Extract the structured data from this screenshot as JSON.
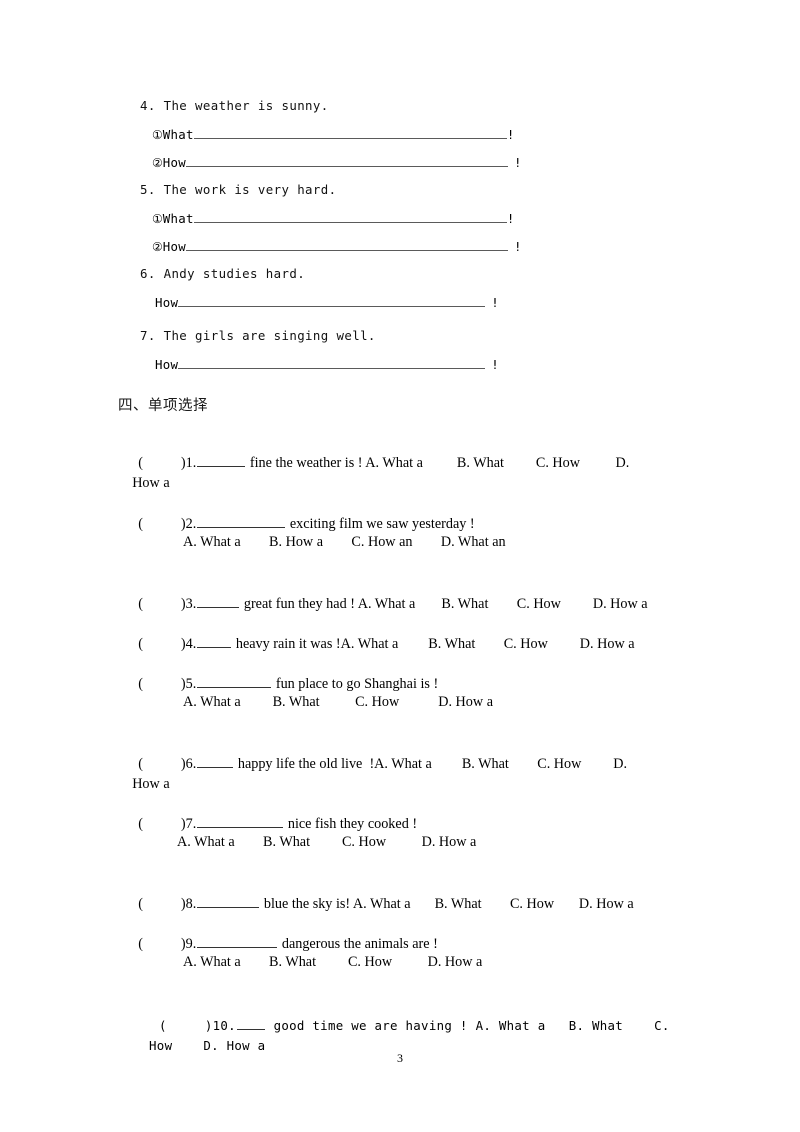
{
  "document": {
    "page_number": "3",
    "section_heading": "四、单项选择"
  },
  "fill_in_exercises": [
    {
      "number": "4.",
      "stem": "4. The weather is sunny.",
      "answers": [
        {
          "marker": "①",
          "lead": "What",
          "punct": "!"
        },
        {
          "marker": "②",
          "lead": "How",
          "punct": "!"
        }
      ]
    },
    {
      "number": "5.",
      "stem": "5. The work is very hard.",
      "answers": [
        {
          "marker": "①",
          "lead": "What",
          "punct": "!"
        },
        {
          "marker": "②",
          "lead": "How",
          "punct": "!"
        }
      ]
    },
    {
      "number": "6.",
      "stem": "6. Andy studies hard.",
      "answers": [
        {
          "marker": "",
          "lead": "How",
          "punct": "!"
        }
      ]
    },
    {
      "number": "7.",
      "stem": "7. The girls are singing well.",
      "answers": [
        {
          "marker": "",
          "lead": "How",
          "punct": "!"
        }
      ]
    }
  ],
  "multiple_choice": [
    {
      "id": "q1",
      "bracket_open": "(",
      "bracket_close": ")",
      "number": "1.",
      "question_text": " fine the weather is ! A. What a",
      "inline_options": "B. What         C. How          D.",
      "wrap_text": "How a",
      "options_line": null
    },
    {
      "id": "q2",
      "bracket_open": "(",
      "bracket_close": ")",
      "number": "2.",
      "question_text": " exciting film we saw yesterday !",
      "inline_options": null,
      "wrap_text": null,
      "options_line": "A. What a        B. How a        C. How an        D. What an"
    },
    {
      "id": "q3",
      "bracket_open": "(",
      "bracket_close": ")",
      "number": "3.",
      "question_text": " great fun they had ! A. What a",
      "inline_options": "B. What        C. How         D. How a",
      "wrap_text": null,
      "options_line": null
    },
    {
      "id": "q4",
      "bracket_open": "(",
      "bracket_close": ")",
      "number": "4.",
      "question_text": " heavy rain it was !A. What a",
      "inline_options": "B. What        C. How         D. How a",
      "wrap_text": null,
      "options_line": null
    },
    {
      "id": "q5",
      "bracket_open": "(",
      "bracket_close": ")",
      "number": "5.",
      "question_text": " fun place to go Shanghai is !",
      "inline_options": null,
      "wrap_text": null,
      "options_line": "A. What a         B. What          C. How           D. How a"
    },
    {
      "id": "q6",
      "bracket_open": "(",
      "bracket_close": ")",
      "number": "6.",
      "question_text": " happy life the old live  !A. What a",
      "inline_options": "B. What        C. How         D.",
      "wrap_text": "How a",
      "options_line": null
    },
    {
      "id": "q7",
      "bracket_open": "(",
      "bracket_close": ")",
      "number": "7.",
      "question_text": " nice fish they cooked !",
      "inline_options": null,
      "wrap_text": null,
      "options_line": "A. What a        B. What         C. How          D. How a"
    },
    {
      "id": "q8",
      "bracket_open": "(",
      "bracket_close": ")",
      "number": "8.",
      "question_text": " blue the sky is! A. What a",
      "inline_options": "B. What        C. How       D. How a",
      "wrap_text": null,
      "options_line": null
    },
    {
      "id": "q9",
      "bracket_open": "(",
      "bracket_close": ")",
      "number": "9.",
      "question_text": " dangerous the animals are !",
      "inline_options": null,
      "wrap_text": null,
      "options_line": "A. What a        B. What         C. How          D. How a"
    },
    {
      "id": "q10",
      "bracket_open": "(",
      "bracket_close": ")",
      "number": "10.",
      "question_text": " good time we are having !",
      "inline_options": "A. What a   B. What    C.",
      "wrap_text": "How    D. How a",
      "options_line": null
    }
  ]
}
